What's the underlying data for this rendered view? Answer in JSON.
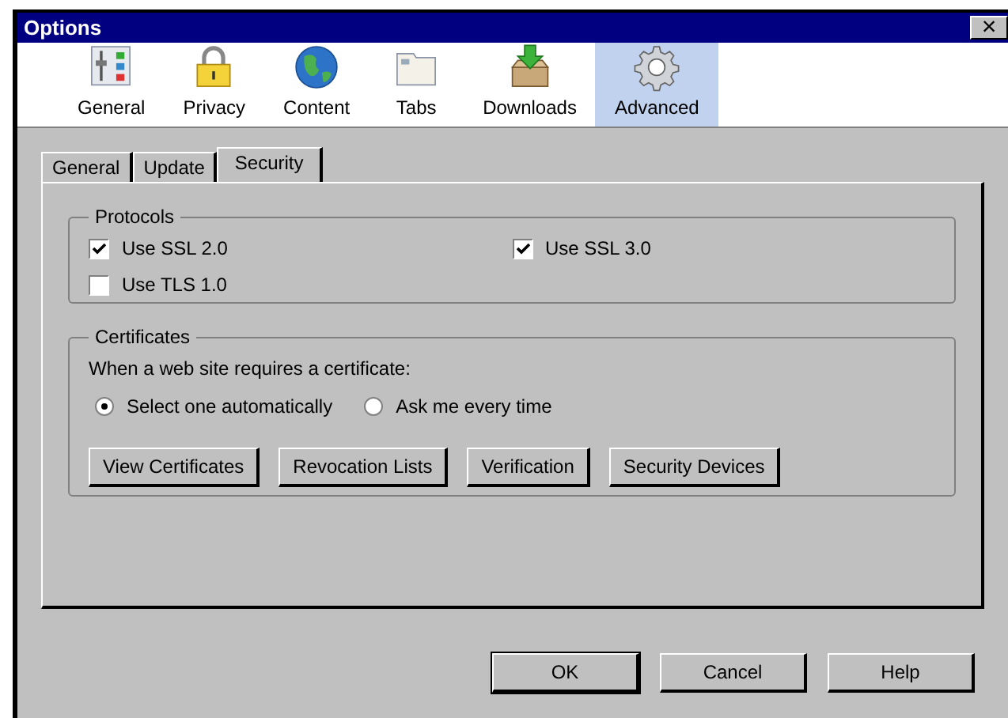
{
  "window": {
    "title": "Options",
    "close": "×"
  },
  "toolbar": [
    {
      "label": "General",
      "selected": false
    },
    {
      "label": "Privacy",
      "selected": false
    },
    {
      "label": "Content",
      "selected": false
    },
    {
      "label": "Tabs",
      "selected": false
    },
    {
      "label": "Downloads",
      "selected": false
    },
    {
      "label": "Advanced",
      "selected": true
    }
  ],
  "tabs": [
    {
      "label": "General",
      "selected": false
    },
    {
      "label": "Update",
      "selected": false
    },
    {
      "label": "Security",
      "selected": true
    }
  ],
  "protocols": {
    "title": "Protocols",
    "options": [
      {
        "label": "Use SSL 2.0",
        "checked": true
      },
      {
        "label": "Use SSL 3.0",
        "checked": true
      },
      {
        "label": "Use TLS 1.0",
        "checked": false
      }
    ]
  },
  "certificates": {
    "title": "Certificates",
    "prompt": "When a web site requires a certificate:",
    "choices": [
      {
        "label": "Select one automatically",
        "selected": true
      },
      {
        "label": "Ask me every time",
        "selected": false
      }
    ],
    "buttons": [
      "View Certificates",
      "Revocation Lists",
      "Verification",
      "Security Devices"
    ]
  },
  "buttons": [
    {
      "label": "OK",
      "default": true
    },
    {
      "label": "Cancel",
      "default": false
    },
    {
      "label": "Help",
      "default": false
    }
  ]
}
